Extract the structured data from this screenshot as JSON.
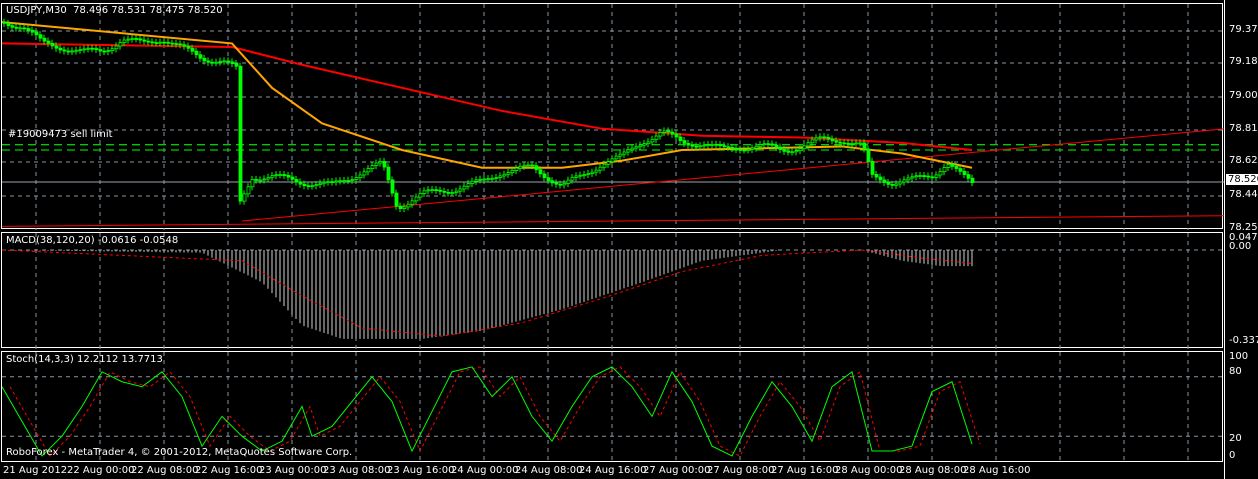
{
  "chart_header": {
    "symbol_tf": "USDJPY,M30",
    "ohlc": "78.496 78.531 78.475 78.520"
  },
  "order_label": "#19009473 sell limit",
  "price_axis": [
    "79.370",
    "79.185",
    "79.000",
    "78.810",
    "78.625",
    "78.440",
    "78.255"
  ],
  "current_price": "78.520",
  "macd": {
    "title": "MACD(38,120,20) -0.0616 -0.0548",
    "axis": [
      "0.0477",
      "0.00",
      "-0.3378"
    ]
  },
  "stoch": {
    "title": "Stoch(14,3,3) 12.2112 13.7713",
    "axis": [
      "100",
      "80",
      "20",
      "0"
    ]
  },
  "footer": "RoboForex - MetaTrader 4, © 2001-2012, MetaQuotes Software Corp.",
  "time_axis": [
    "21 Aug 2012",
    "22 Aug 00:00",
    "22 Aug 08:00",
    "22 Aug 16:00",
    "23 Aug 00:00",
    "23 Aug 08:00",
    "23 Aug 16:00",
    "24 Aug 00:00",
    "24 Aug 08:00",
    "24 Aug 16:00",
    "27 Aug 00:00",
    "27 Aug 08:00",
    "27 Aug 16:00",
    "28 Aug 00:00",
    "28 Aug 08:00",
    "28 Aug 16:00"
  ],
  "colors": {
    "candle": "#00ff00",
    "fast_ma": "#ffa500",
    "slow_ma": "#ff0000",
    "grid": "#8a96a6",
    "order": "#00cc00"
  },
  "chart_data": {
    "type": "line",
    "close_points": [
      [
        0,
        79.42
      ],
      [
        20,
        79.4
      ],
      [
        40,
        79.3
      ],
      [
        60,
        79.28
      ],
      [
        80,
        79.25
      ],
      [
        100,
        79.26
      ],
      [
        120,
        79.32
      ],
      [
        140,
        79.3
      ],
      [
        160,
        79.33
      ],
      [
        180,
        79.27
      ],
      [
        200,
        79.22
      ],
      [
        220,
        79.2
      ],
      [
        235,
        79.15
      ],
      [
        238,
        78.4
      ],
      [
        250,
        78.55
      ],
      [
        270,
        78.55
      ],
      [
        300,
        78.52
      ],
      [
        330,
        78.5
      ],
      [
        360,
        78.58
      ],
      [
        380,
        78.62
      ],
      [
        395,
        78.38
      ],
      [
        420,
        78.45
      ],
      [
        450,
        78.48
      ],
      [
        480,
        78.52
      ],
      [
        500,
        78.58
      ],
      [
        530,
        78.6
      ],
      [
        560,
        78.5
      ],
      [
        580,
        78.55
      ],
      [
        600,
        78.63
      ],
      [
        620,
        78.66
      ],
      [
        640,
        78.75
      ],
      [
        660,
        78.8
      ],
      [
        680,
        78.74
      ],
      [
        700,
        78.74
      ],
      [
        720,
        78.7
      ],
      [
        740,
        78.72
      ],
      [
        760,
        78.72
      ],
      [
        780,
        78.7
      ],
      [
        800,
        78.72
      ],
      [
        820,
        78.76
      ],
      [
        840,
        78.76
      ],
      [
        860,
        78.72
      ],
      [
        870,
        78.55
      ],
      [
        890,
        78.52
      ],
      [
        910,
        78.53
      ],
      [
        930,
        78.56
      ],
      [
        945,
        78.63
      ],
      [
        960,
        78.55
      ],
      [
        970,
        78.51
      ]
    ],
    "fast_ma": [
      [
        0,
        79.42
      ],
      [
        230,
        79.3
      ],
      [
        270,
        79.05
      ],
      [
        320,
        78.85
      ],
      [
        400,
        78.7
      ],
      [
        480,
        78.6
      ],
      [
        560,
        78.6
      ],
      [
        620,
        78.64
      ],
      [
        680,
        78.7
      ],
      [
        760,
        78.71
      ],
      [
        840,
        78.72
      ],
      [
        900,
        78.68
      ],
      [
        970,
        78.6
      ]
    ],
    "slow_ma": [
      [
        0,
        79.3
      ],
      [
        230,
        79.28
      ],
      [
        300,
        79.18
      ],
      [
        400,
        79.05
      ],
      [
        500,
        78.92
      ],
      [
        600,
        78.82
      ],
      [
        700,
        78.78
      ],
      [
        800,
        78.77
      ],
      [
        900,
        78.74
      ],
      [
        970,
        78.7
      ]
    ],
    "trendlines": [
      [
        [
          240,
          78.3
        ],
        [
          1224,
          78.82
        ]
      ],
      [
        [
          0,
          78.27
        ],
        [
          1224,
          78.33
        ]
      ]
    ],
    "order_levels": [
      78.73,
      78.7
    ],
    "macd_hist": [
      [
        0,
        0
      ],
      [
        200,
        -0.01
      ],
      [
        260,
        -0.12
      ],
      [
        300,
        -0.28
      ],
      [
        340,
        -0.33
      ],
      [
        420,
        -0.33
      ],
      [
        480,
        -0.3
      ],
      [
        560,
        -0.22
      ],
      [
        640,
        -0.12
      ],
      [
        700,
        -0.04
      ],
      [
        780,
        0
      ],
      [
        860,
        0
      ],
      [
        900,
        -0.04
      ],
      [
        940,
        -0.06
      ],
      [
        970,
        -0.06
      ]
    ],
    "macd_signal": [
      [
        0,
        0
      ],
      [
        240,
        -0.04
      ],
      [
        300,
        -0.17
      ],
      [
        360,
        -0.29
      ],
      [
        440,
        -0.32
      ],
      [
        520,
        -0.27
      ],
      [
        600,
        -0.18
      ],
      [
        680,
        -0.08
      ],
      [
        760,
        -0.02
      ],
      [
        860,
        0
      ],
      [
        920,
        -0.03
      ],
      [
        970,
        -0.05
      ]
    ],
    "stoch_main": [
      [
        0,
        70
      ],
      [
        20,
        35
      ],
      [
        40,
        0
      ],
      [
        60,
        20
      ],
      [
        80,
        50
      ],
      [
        100,
        85
      ],
      [
        120,
        75
      ],
      [
        140,
        70
      ],
      [
        160,
        85
      ],
      [
        180,
        60
      ],
      [
        200,
        10
      ],
      [
        220,
        40
      ],
      [
        240,
        20
      ],
      [
        260,
        5
      ],
      [
        280,
        15
      ],
      [
        300,
        50
      ],
      [
        310,
        20
      ],
      [
        330,
        30
      ],
      [
        350,
        55
      ],
      [
        370,
        80
      ],
      [
        390,
        55
      ],
      [
        410,
        5
      ],
      [
        430,
        45
      ],
      [
        450,
        85
      ],
      [
        470,
        90
      ],
      [
        490,
        60
      ],
      [
        510,
        80
      ],
      [
        530,
        40
      ],
      [
        550,
        15
      ],
      [
        570,
        50
      ],
      [
        590,
        80
      ],
      [
        610,
        90
      ],
      [
        630,
        70
      ],
      [
        650,
        40
      ],
      [
        670,
        85
      ],
      [
        690,
        55
      ],
      [
        710,
        10
      ],
      [
        730,
        0
      ],
      [
        750,
        40
      ],
      [
        770,
        75
      ],
      [
        790,
        50
      ],
      [
        810,
        15
      ],
      [
        830,
        70
      ],
      [
        850,
        85
      ],
      [
        870,
        5
      ],
      [
        890,
        5
      ],
      [
        910,
        10
      ],
      [
        930,
        65
      ],
      [
        950,
        75
      ],
      [
        970,
        12
      ]
    ],
    "stoch_signal_lag": 8,
    "ylim": [
      78.255,
      79.37
    ]
  }
}
